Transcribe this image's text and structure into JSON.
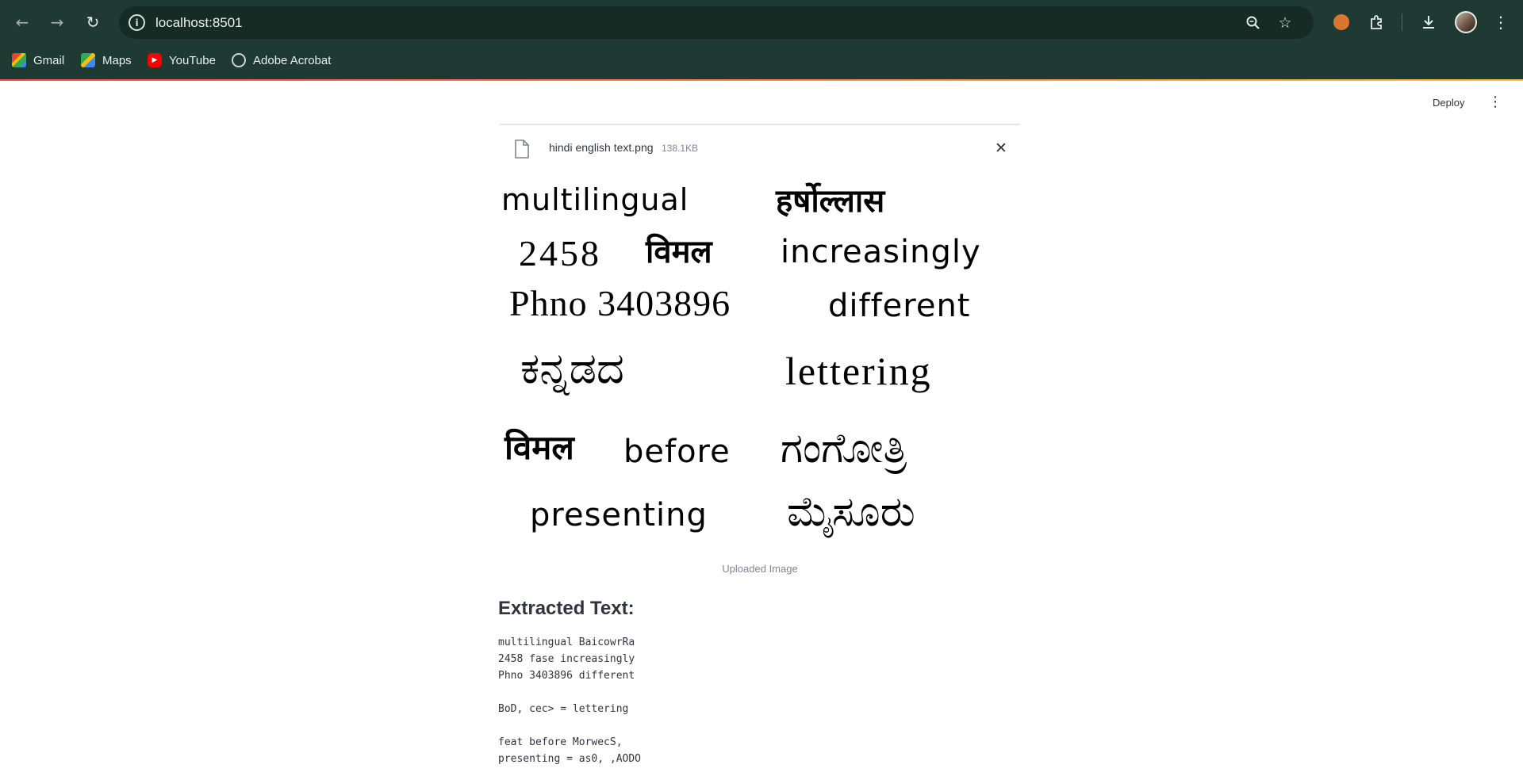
{
  "browser": {
    "url": "localhost:8501",
    "bookmarks": [
      {
        "label": "Gmail",
        "icon": "gmail-icon"
      },
      {
        "label": "Maps",
        "icon": "maps-icon"
      },
      {
        "label": "YouTube",
        "icon": "youtube-icon"
      },
      {
        "label": "Adobe Acrobat",
        "icon": "globe-icon"
      }
    ]
  },
  "app": {
    "deploy_label": "Deploy",
    "uploader": {
      "file_name": "hindi english text.png",
      "file_size": "138.1KB"
    },
    "image": {
      "words": [
        "multilingual",
        "हर्षोल्लास",
        "2458",
        "विमल",
        "increasingly",
        "Phno 3403896",
        "different",
        "ಕನ್ನಡದ",
        "lettering",
        "विमल",
        "before",
        "ಗಂಗೋತ್ರಿ",
        "presenting",
        "ಮೈಸೂರು"
      ],
      "caption": "Uploaded Image"
    },
    "extracted": {
      "title": "Extracted Text:",
      "lines": [
        "multilingual BaicowrRa",
        "2458 fase increasingly",
        "Phno 3403896 different",
        "",
        "BoD, cec> = lettering",
        "",
        "feat before MorwecS,",
        "presenting = as0, ,AODO"
      ]
    }
  }
}
